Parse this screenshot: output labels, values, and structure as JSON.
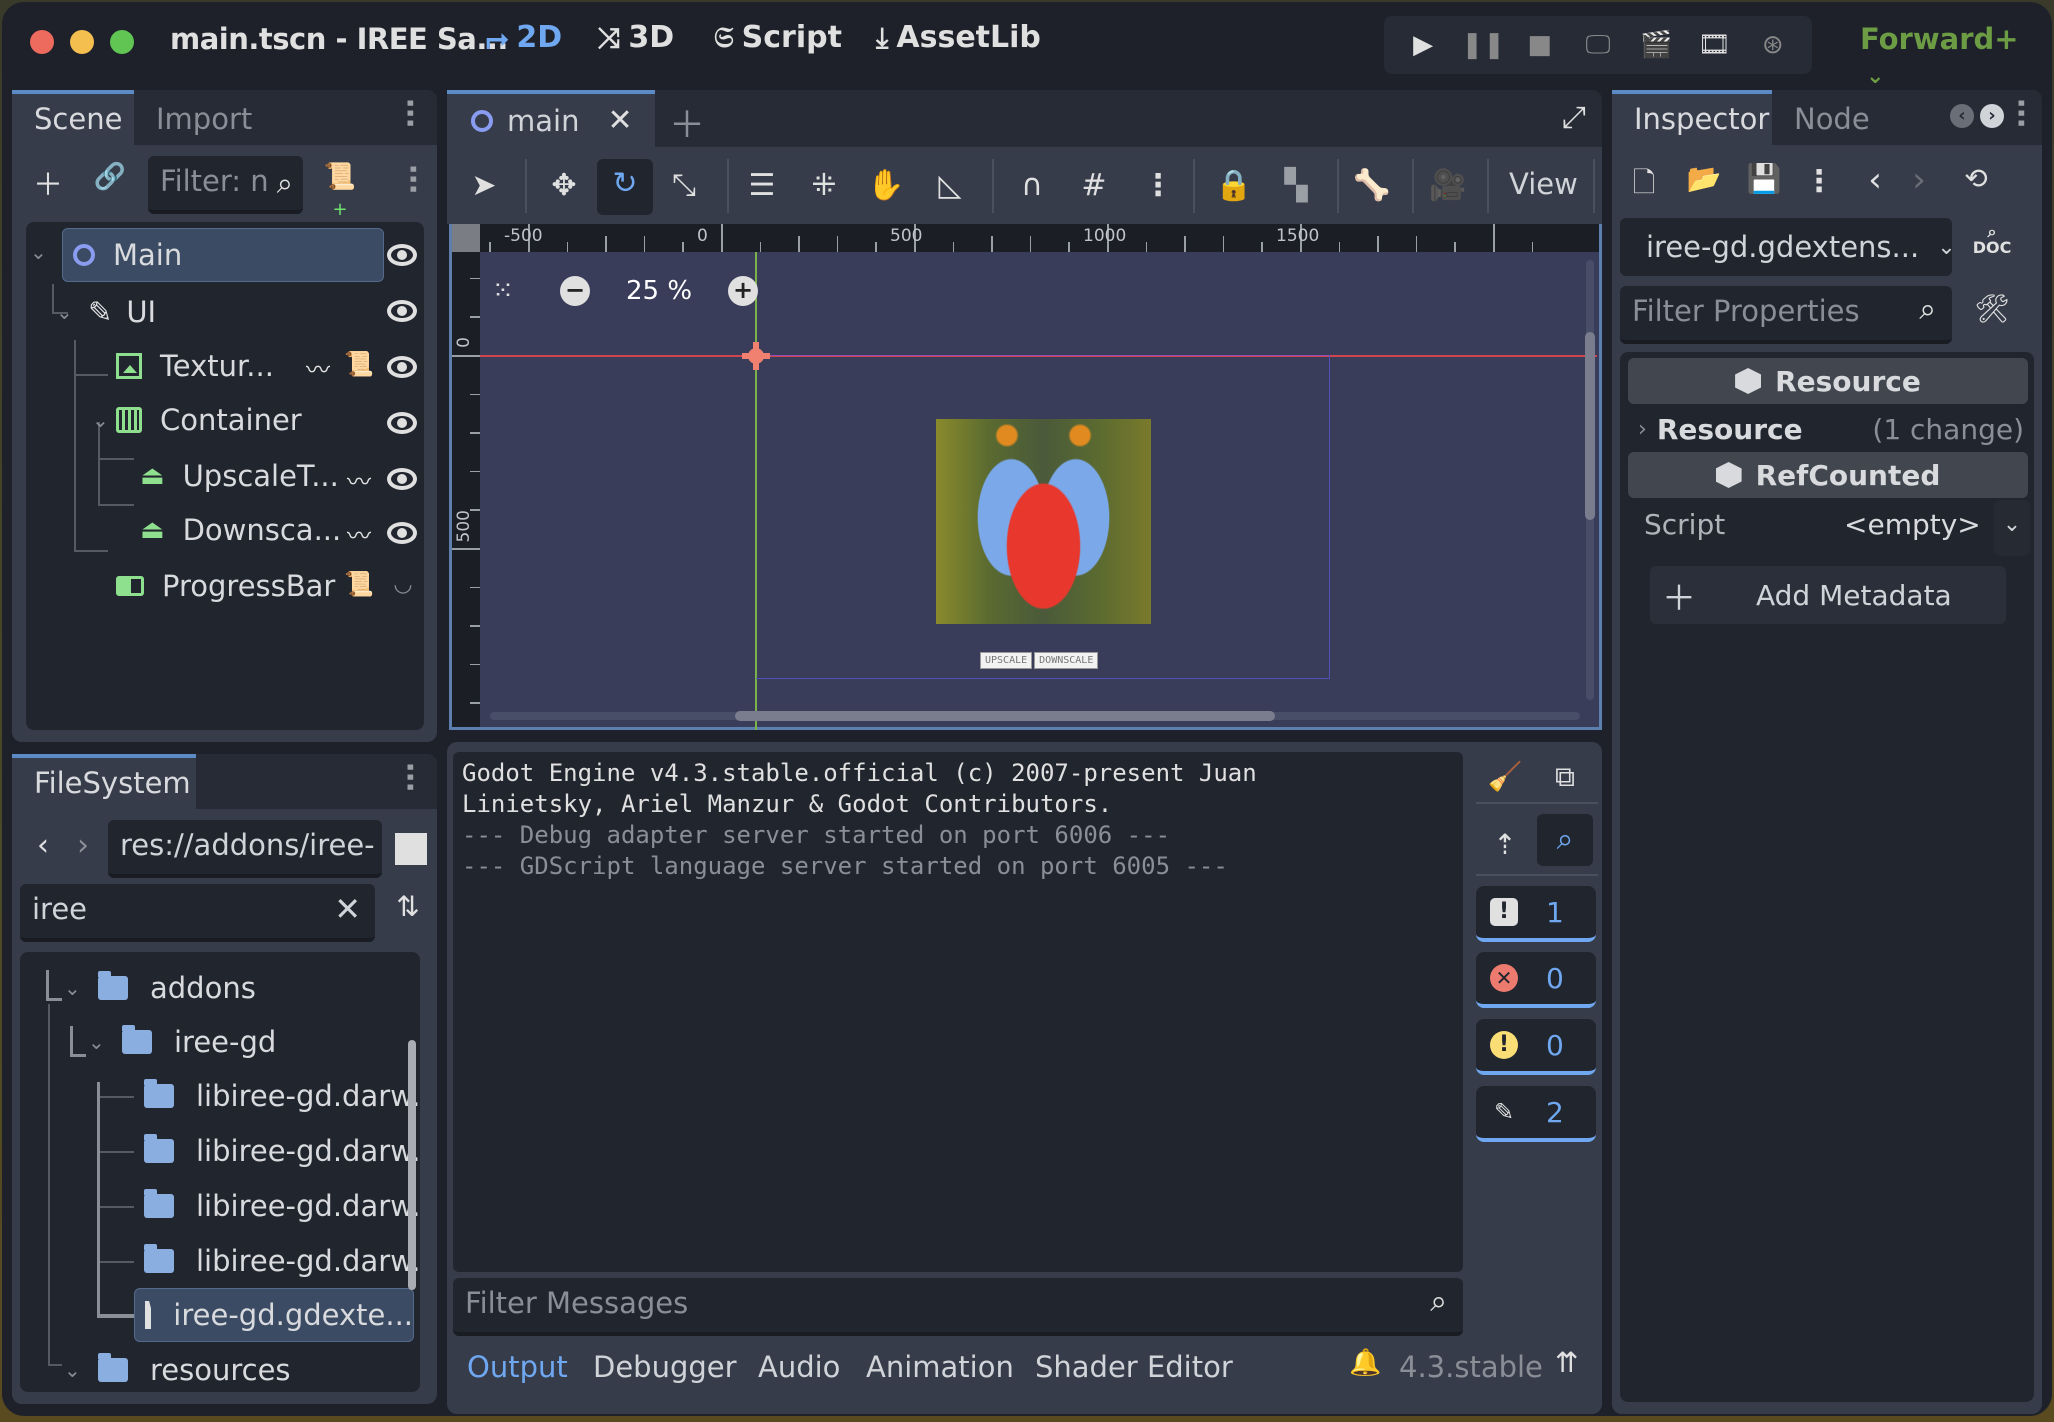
{
  "titlebar": {
    "title": "main.tscn - IREE Sa...",
    "workspaces": [
      {
        "label": "2D",
        "icon": "2d-icon",
        "active": true
      },
      {
        "label": "3D",
        "icon": "3d-icon",
        "active": false
      },
      {
        "label": "Script",
        "icon": "script-icon",
        "active": false
      },
      {
        "label": "AssetLib",
        "icon": "download-icon",
        "active": false
      }
    ],
    "play_controls": [
      "play-icon",
      "pause-icon",
      "stop-icon",
      "remote-debug-icon",
      "play-scene-icon",
      "play-custom-scene-icon",
      "movie-maker-icon"
    ],
    "renderer": "Forward+",
    "colors": {
      "close": "#ec6a5e",
      "minimize": "#f4bf4f",
      "maximize": "#61c554",
      "accent": "#6fa8f0",
      "renderer": "#6c9c44"
    }
  },
  "scene_dock": {
    "tabs": [
      "Scene",
      "Import"
    ],
    "active_tab": "Scene",
    "filter_placeholder": "Filter: n",
    "nodes": [
      {
        "name": "Main",
        "icon": "node2d-circle-icon",
        "depth": 0,
        "expanded": true,
        "selected": true,
        "badges": [],
        "visible": true
      },
      {
        "name": "UI",
        "icon": "control-icon",
        "depth": 1,
        "expanded": true,
        "badges": [],
        "visible": true
      },
      {
        "name": "Textur...",
        "icon": "texture-rect-icon",
        "depth": 2,
        "badges": [
          "signal-icon",
          "script-icon"
        ],
        "visible": true
      },
      {
        "name": "Container",
        "icon": "hbox-container-icon",
        "depth": 2,
        "expanded": true,
        "badges": [],
        "visible": true
      },
      {
        "name": "UpscaleT...",
        "icon": "button-icon",
        "depth": 3,
        "badges": [
          "signal-icon"
        ],
        "visible": true
      },
      {
        "name": "Downsca...",
        "icon": "button-icon",
        "depth": 3,
        "badges": [
          "signal-icon"
        ],
        "visible": true
      },
      {
        "name": "ProgressBar",
        "icon": "progress-bar-icon",
        "depth": 2,
        "badges": [
          "script-icon"
        ],
        "visible": false
      }
    ]
  },
  "filesystem_dock": {
    "tab": "FileSystem",
    "path": "res://addons/iree-",
    "search": "iree",
    "items": [
      {
        "name": "addons",
        "type": "folder",
        "depth": 1
      },
      {
        "name": "iree-gd",
        "type": "folder",
        "depth": 2
      },
      {
        "name": "libiree-gd.darw...",
        "type": "folder",
        "depth": 3
      },
      {
        "name": "libiree-gd.darw...",
        "type": "folder",
        "depth": 3
      },
      {
        "name": "libiree-gd.darw...",
        "type": "folder",
        "depth": 3
      },
      {
        "name": "libiree-gd.darw...",
        "type": "folder",
        "depth": 3
      },
      {
        "name": "iree-gd.gdexte...",
        "type": "file",
        "depth": 3,
        "selected": true
      },
      {
        "name": "resources",
        "type": "folder",
        "depth": 1
      }
    ]
  },
  "editor": {
    "scene_tab": "main",
    "toolbar_view_label": "View",
    "zoom": "25 %",
    "ruler_h": [
      "-500",
      "0",
      "500",
      "1000",
      "1500"
    ],
    "ruler_v": [
      "0",
      "500"
    ],
    "scene_buttons": [
      "UPSCALE",
      "DOWNSCALE"
    ]
  },
  "output": {
    "lines": [
      {
        "text": "Godot Engine v4.3.stable.official (c) 2007-present Juan",
        "style": "bright"
      },
      {
        "text": "Linietsky, Ariel Manzur & Godot Contributors.",
        "style": "bright"
      },
      {
        "text": "--- Debug adapter server started on port 6006 ---",
        "style": "dim"
      },
      {
        "text": "--- GDScript language server started on port 6005 ---",
        "style": "dim"
      }
    ],
    "filter_placeholder": "Filter Messages",
    "counters": [
      {
        "type": "message",
        "count": "1",
        "color": "#e0e0e0"
      },
      {
        "type": "error",
        "count": "0",
        "color": "#ec7a6e"
      },
      {
        "type": "warning",
        "count": "0",
        "color": "#fbdd76"
      },
      {
        "type": "editor",
        "count": "2",
        "color": "#e0e0e0"
      }
    ],
    "bottom_tabs": [
      "Output",
      "Debugger",
      "Audio",
      "Animation",
      "Shader Editor"
    ],
    "active_bottom_tab": "Output",
    "version": "4.3.stable"
  },
  "inspector": {
    "tabs": [
      "Inspector",
      "Node"
    ],
    "active_tab": "Inspector",
    "resource_name": "iree-gd.gdextens...",
    "filter_placeholder": "Filter Properties",
    "sections": [
      {
        "kind": "header",
        "label": "Resource"
      },
      {
        "kind": "group",
        "label": "Resource",
        "note": "(1 change)"
      },
      {
        "kind": "header",
        "label": "RefCounted"
      }
    ],
    "script_label": "Script",
    "script_value": "<empty>",
    "add_metadata_label": "Add Metadata"
  }
}
